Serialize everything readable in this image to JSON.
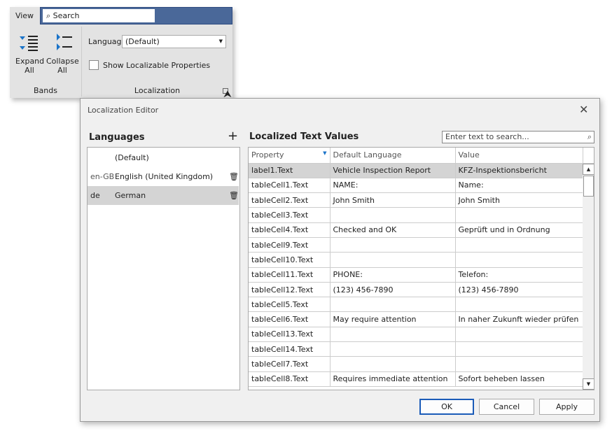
{
  "ribbon": {
    "tab": "View",
    "search_placeholder": "Search",
    "expand_label": "Expand\nAll",
    "collapse_label": "Collapse\nAll",
    "bands_group": "Bands",
    "language_label": "Language",
    "language_value": "(Default)",
    "show_localizable": "Show Localizable Properties",
    "show_localizable_checked": false,
    "localization_group": "Localization"
  },
  "dialog": {
    "title": "Localization Editor",
    "languages_title": "Languages",
    "languages": [
      {
        "code": "",
        "name": "(Default)"
      },
      {
        "code": "en-GB",
        "name": "English (United Kingdom)"
      },
      {
        "code": "de",
        "name": "German"
      }
    ],
    "selected_language": "de",
    "values_title": "Localized Text Values",
    "search_placeholder": "Enter text to search...",
    "columns": [
      "Property",
      "Default Language",
      "Value"
    ],
    "rows": [
      [
        "label1.Text",
        "Vehicle Inspection Report",
        "KFZ-Inspektionsbericht"
      ],
      [
        "tableCell1.Text",
        "NAME:",
        "Name:"
      ],
      [
        "tableCell2.Text",
        "John Smith",
        "John Smith"
      ],
      [
        "tableCell3.Text",
        "",
        ""
      ],
      [
        "tableCell4.Text",
        "Checked and OK",
        "Geprüft und in Ordnung"
      ],
      [
        "tableCell9.Text",
        "",
        ""
      ],
      [
        "tableCell10.Text",
        "",
        ""
      ],
      [
        "tableCell11.Text",
        "PHONE:",
        "Telefon:"
      ],
      [
        "tableCell12.Text",
        "(123) 456-7890",
        "(123) 456-7890"
      ],
      [
        "tableCell5.Text",
        "",
        ""
      ],
      [
        "tableCell6.Text",
        "May require attention",
        "In naher Zukunft wieder prüfen"
      ],
      [
        "tableCell13.Text",
        "",
        ""
      ],
      [
        "tableCell14.Text",
        "",
        ""
      ],
      [
        "tableCell7.Text",
        "",
        ""
      ],
      [
        "tableCell8.Text",
        "Requires immediate attention",
        "Sofort beheben lassen"
      ]
    ],
    "buttons": {
      "ok": "OK",
      "cancel": "Cancel",
      "apply": "Apply"
    }
  },
  "colors": {
    "accent": "#4a6899",
    "selection": "#d4d4d4",
    "icon_blue": "#1a73c8"
  }
}
